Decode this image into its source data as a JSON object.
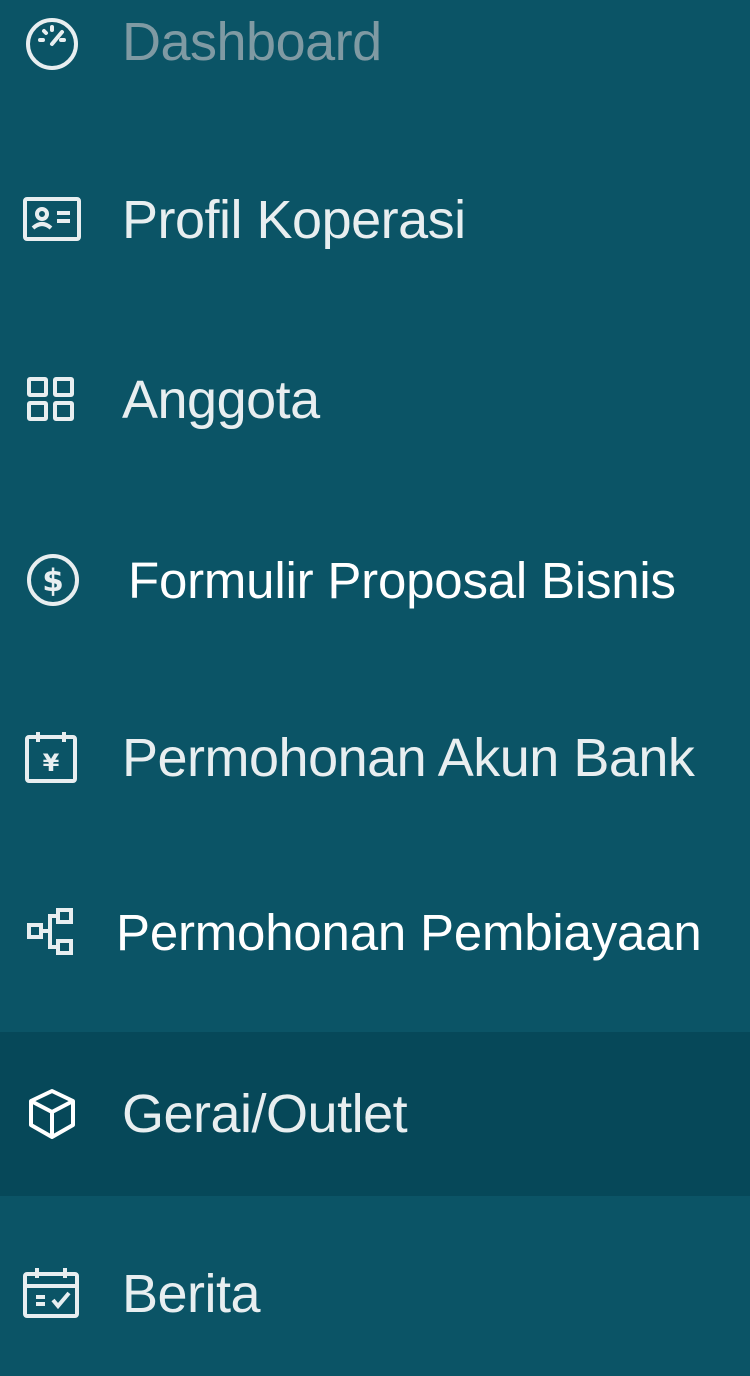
{
  "sidebar": {
    "items": [
      {
        "label": "Dashboard",
        "icon": "dashboard-gauge-icon"
      },
      {
        "label": "Profil Koperasi",
        "icon": "id-card-icon"
      },
      {
        "label": "Anggota",
        "icon": "grid-icon"
      },
      {
        "label": "Formulir Proposal Bisnis",
        "icon": "dollar-circle-icon"
      },
      {
        "label": "Permohonan Akun Bank",
        "icon": "yen-calendar-icon"
      },
      {
        "label": "Permohonan Pembiayaan",
        "icon": "cluster-icon"
      },
      {
        "label": "Gerai/Outlet",
        "icon": "box-icon",
        "active": true
      },
      {
        "label": "Berita",
        "icon": "calendar-check-icon"
      }
    ]
  },
  "colors": {
    "background": "#0b5466",
    "active_background": "#064859",
    "text": "#e8eef0",
    "dim_text": "#7f9aa3"
  }
}
